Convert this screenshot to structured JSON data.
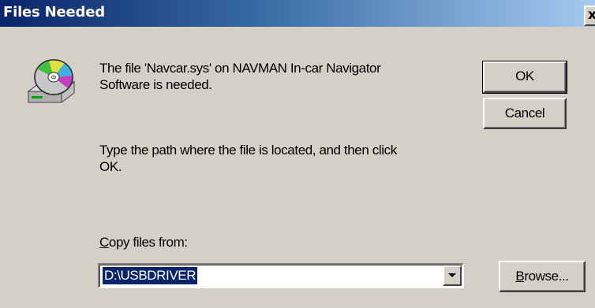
{
  "window": {
    "title": "Files Needed",
    "close_glyph": "x",
    "icon": "cd-drive-icon"
  },
  "message": {
    "line1": "The file 'Navcar.sys' on NAVMAN In-car Navigator\nSoftware is needed.",
    "line2": "Type the path where the file is located, and then click\nOK."
  },
  "copy_from": {
    "label_accel": "C",
    "label_rest": "opy files from:",
    "value": "D:\\USBDRIVER"
  },
  "buttons": {
    "ok": "OK",
    "cancel": "Cancel",
    "browse_accel": "B",
    "browse_rest": "rowse..."
  },
  "colors": {
    "titlebar_start": "#0a246a",
    "titlebar_end": "#a6caf0",
    "face": "#d4d0c8",
    "selection": "#0a246a"
  }
}
